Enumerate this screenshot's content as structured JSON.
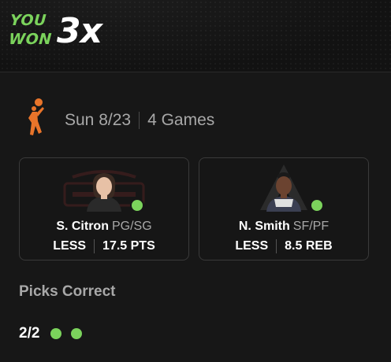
{
  "banner": {
    "you": "YOU",
    "won": "WON",
    "multiplier": "3x",
    "accent_color": "#7bd35c"
  },
  "game": {
    "league_icon": "wnba-logo-icon",
    "date": "Sun 8/23",
    "games": "4 Games"
  },
  "picks": [
    {
      "name": "S. Citron",
      "position": "PG/SG",
      "direction": "LESS",
      "line": "17.5 PTS",
      "team_watermark": "mystics-logo",
      "result": "correct"
    },
    {
      "name": "N. Smith",
      "position": "SF/PF",
      "direction": "LESS",
      "line": "8.5 REB",
      "team_watermark": "aces-logo",
      "result": "correct"
    }
  ],
  "summary": {
    "title": "Picks Correct",
    "count": "2/2",
    "dots": 2
  }
}
